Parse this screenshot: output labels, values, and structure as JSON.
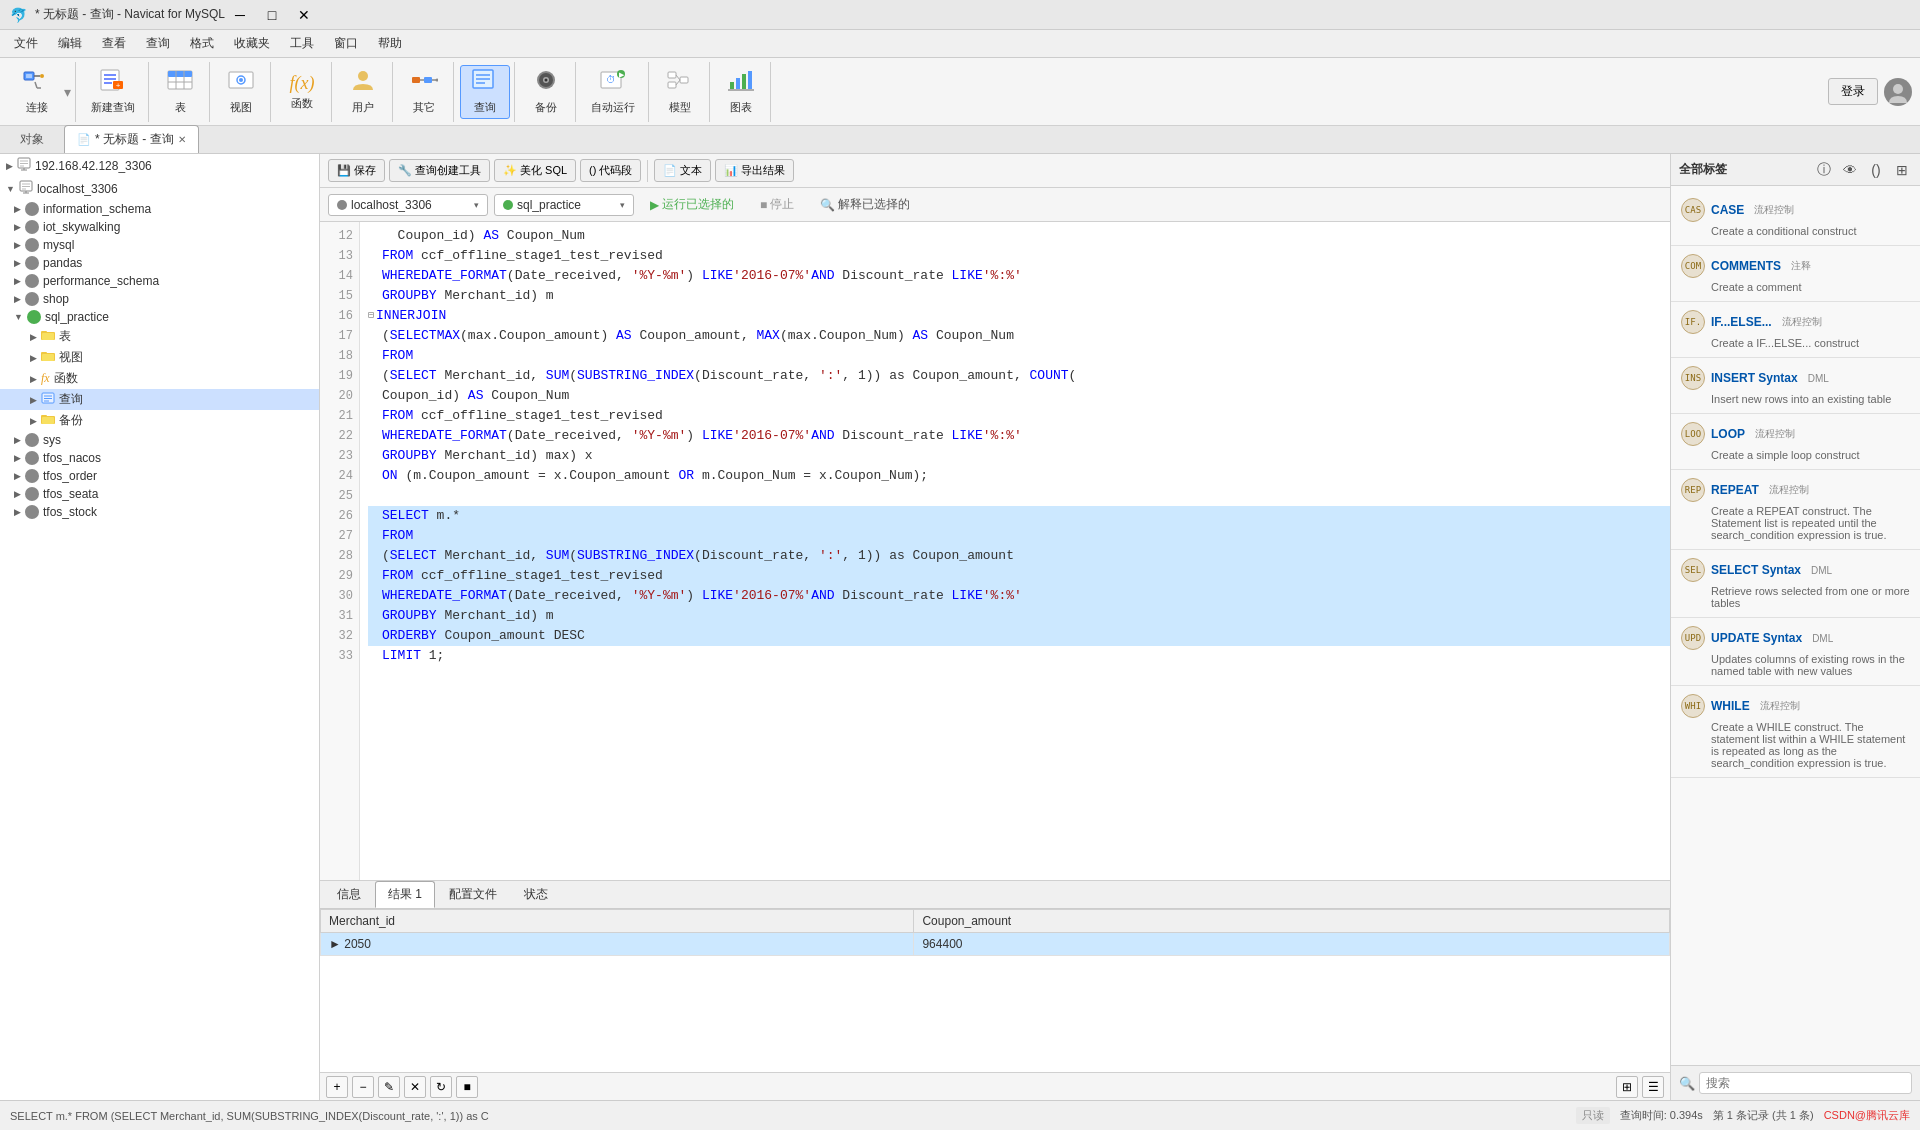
{
  "titleBar": {
    "title": "* 无标题 - 查询 - Navicat for MySQL",
    "minBtn": "─",
    "maxBtn": "□",
    "closeBtn": "✕"
  },
  "menuBar": {
    "items": [
      "文件",
      "编辑",
      "查看",
      "查询",
      "格式",
      "收藏夹",
      "工具",
      "窗口",
      "帮助"
    ]
  },
  "toolbar": {
    "buttons": [
      {
        "id": "connect",
        "icon": "🔌",
        "label": "连接"
      },
      {
        "id": "new-query",
        "icon": "📋",
        "label": "新建查询"
      },
      {
        "id": "table",
        "icon": "⊞",
        "label": "表"
      },
      {
        "id": "view",
        "icon": "👁",
        "label": "视图"
      },
      {
        "id": "function",
        "icon": "ƒx",
        "label": "函数"
      },
      {
        "id": "user",
        "icon": "👤",
        "label": "用户"
      },
      {
        "id": "other",
        "icon": "🔧",
        "label": "其它"
      },
      {
        "id": "query",
        "icon": "📊",
        "label": "查询"
      },
      {
        "id": "backup",
        "icon": "💿",
        "label": "备份"
      },
      {
        "id": "autorun",
        "icon": "⏱",
        "label": "自动运行"
      },
      {
        "id": "model",
        "icon": "📐",
        "label": "模型"
      },
      {
        "id": "chart",
        "icon": "📈",
        "label": "图表"
      }
    ],
    "loginBtn": "登录"
  },
  "tabs": {
    "objTab": "对象",
    "queryTab": "* 无标题 - 查询"
  },
  "sidebar": {
    "connections": [
      {
        "name": "192.168.42.128_3306",
        "icon": "network",
        "expanded": false
      },
      {
        "name": "localhost_3306",
        "icon": "network",
        "expanded": true,
        "databases": [
          {
            "name": "information_schema",
            "icon": "gray",
            "expanded": false
          },
          {
            "name": "iot_skywalking",
            "icon": "gray",
            "expanded": false
          },
          {
            "name": "mysql",
            "icon": "gray",
            "expanded": false
          },
          {
            "name": "pandas",
            "icon": "gray",
            "expanded": false
          },
          {
            "name": "performance_schema",
            "icon": "gray",
            "expanded": false
          },
          {
            "name": "shop",
            "icon": "gray",
            "expanded": false
          },
          {
            "name": "sql_practice",
            "icon": "green",
            "expanded": true,
            "items": [
              {
                "name": "表",
                "icon": "table",
                "expanded": false
              },
              {
                "name": "视图",
                "icon": "view",
                "expanded": false
              },
              {
                "name": "函数",
                "icon": "func",
                "expanded": false
              },
              {
                "name": "查询",
                "icon": "query",
                "expanded": false,
                "selected": true
              },
              {
                "name": "备份",
                "icon": "backup",
                "expanded": false
              }
            ]
          },
          {
            "name": "sys",
            "icon": "gray",
            "expanded": false
          },
          {
            "name": "tfos_nacos",
            "icon": "gray",
            "expanded": false
          },
          {
            "name": "tfos_order",
            "icon": "gray",
            "expanded": false
          },
          {
            "name": "tfos_seata",
            "icon": "gray",
            "expanded": false
          },
          {
            "name": "tfos_stock",
            "icon": "gray",
            "expanded": false
          }
        ]
      }
    ]
  },
  "editorToolbar": {
    "saveBtn": "保存",
    "queryToolBtn": "查询创建工具",
    "beautifyBtn": "美化 SQL",
    "codeBlockBtn": "() 代码段",
    "textBtn": "文本",
    "exportBtn": "导出结果"
  },
  "selectorBar": {
    "connection": "localhost_3306",
    "database": "sql_practice",
    "runBtn": "▶ 运行已选择的",
    "stopBtn": "■ 停止",
    "explainBtn": "🔍 解释已选择的"
  },
  "codeLines": [
    {
      "num": 12,
      "text": "  Coupon_id) AS Coupon_Num",
      "highlighted": false
    },
    {
      "num": 13,
      "text": "FROM ccf_offline_stage1_test_revised",
      "highlighted": false
    },
    {
      "num": 14,
      "text": "WHERE DATE_FORMAT(Date_received, '%Y-%m') LIKE '2016-07%' AND Discount_rate LIKE '%:%'",
      "highlighted": false
    },
    {
      "num": 15,
      "text": "GROUP BY Merchant_id) m",
      "highlighted": false
    },
    {
      "num": 16,
      "text": "INNER JOIN",
      "highlighted": false,
      "fold": true
    },
    {
      "num": 17,
      "text": "(SELECT MAX(max.Coupon_amount) AS Coupon_amount, MAX(max.Coupon_Num) AS Coupon_Num",
      "highlighted": false
    },
    {
      "num": 18,
      "text": "FROM",
      "highlighted": false
    },
    {
      "num": 19,
      "text": "(SELECT Merchant_id, SUM(SUBSTRING_INDEX(Discount_rate, ':', 1)) as Coupon_amount, COUNT(",
      "highlighted": false
    },
    {
      "num": 20,
      "text": "Coupon_id) AS Coupon_Num",
      "highlighted": false
    },
    {
      "num": 21,
      "text": "FROM ccf_offline_stage1_test_revised",
      "highlighted": false
    },
    {
      "num": 22,
      "text": "WHERE DATE_FORMAT(Date_received, '%Y-%m') LIKE '2016-07%' AND Discount_rate LIKE '%:%'",
      "highlighted": false
    },
    {
      "num": 23,
      "text": "GROUP BY Merchant_id) max) x",
      "highlighted": false
    },
    {
      "num": 24,
      "text": "ON (m.Coupon_amount = x.Coupon_amount OR m.Coupon_Num = x.Coupon_Num);",
      "highlighted": false
    },
    {
      "num": 25,
      "text": "",
      "highlighted": false
    },
    {
      "num": 26,
      "text": "SELECT m.*",
      "highlighted": true
    },
    {
      "num": 27,
      "text": "FROM",
      "highlighted": true
    },
    {
      "num": 28,
      "text": "(SELECT Merchant_id, SUM(SUBSTRING_INDEX(Discount_rate, ':', 1)) as Coupon_amount",
      "highlighted": true
    },
    {
      "num": 29,
      "text": "FROM ccf_offline_stage1_test_revised",
      "highlighted": true
    },
    {
      "num": 30,
      "text": "WHERE DATE_FORMAT(Date_received, '%Y-%m') LIKE '2016-07%' AND Discount_rate LIKE '%:%'",
      "highlighted": true
    },
    {
      "num": 31,
      "text": "GROUP BY Merchant_id) m",
      "highlighted": true
    },
    {
      "num": 32,
      "text": "ORDER BY Coupon_amount DESC",
      "highlighted": true
    },
    {
      "num": 33,
      "text": "LIMIT 1;",
      "highlighted": false
    }
  ],
  "resultsTabs": [
    {
      "label": "信息",
      "active": false
    },
    {
      "label": "结果 1",
      "active": true
    },
    {
      "label": "配置文件",
      "active": false
    },
    {
      "label": "状态",
      "active": false
    }
  ],
  "resultsColumns": [
    "Merchant_id",
    "Coupon_amount"
  ],
  "resultsData": [
    {
      "merchant_id": "2050",
      "coupon_amount": "964400",
      "selected": true
    }
  ],
  "resultsToolbar": {
    "addBtn": "+",
    "deleteBtn": "−",
    "editBtn": "✎",
    "cancelBtn": "✕",
    "refreshBtn": "↻",
    "stopBtn": "■",
    "gridViewBtn": "⊞",
    "formViewBtn": "☰"
  },
  "rightPanel": {
    "title": "全部标签",
    "snippets": [
      {
        "name": "CASE",
        "tag": "流程控制",
        "desc": "Create a conditional construct"
      },
      {
        "name": "COMMENTS",
        "tag": "注释",
        "desc": "Create a comment"
      },
      {
        "name": "IF...ELSE...",
        "tag": "流程控制",
        "desc": "Create a IF...ELSE... construct"
      },
      {
        "name": "INSERT Syntax",
        "tag": "DML",
        "desc": "Insert new rows into an existing table"
      },
      {
        "name": "LOOP",
        "tag": "流程控制",
        "desc": "Create a simple loop construct"
      },
      {
        "name": "REPEAT",
        "tag": "流程控制",
        "desc": "Create a REPEAT construct. The Statement list is repeated until the search_condition expression is true."
      },
      {
        "name": "SELECT Syntax",
        "tag": "DML",
        "desc": "Retrieve rows selected from one or more tables"
      },
      {
        "name": "UPDATE Syntax",
        "tag": "DML",
        "desc": "Updates columns of existing rows in the named table with new values"
      },
      {
        "name": "WHILE",
        "tag": "流程控制",
        "desc": "Create a WHILE construct. The statement list within a WHILE statement is repeated as long as the search_condition expression is true."
      }
    ],
    "searchPlaceholder": "搜索"
  },
  "statusBar": {
    "sql": "SELECT m.* FROM (SELECT Merchant_id, SUM(SUBSTRING_INDEX(Discount_rate, ':', 1)) as C",
    "readonly": "只读",
    "queryTime": "查询时间: 0.394s",
    "records": "第 1 条记录 (共 1 条)",
    "csdn": "CSDN@腾讯云库"
  }
}
